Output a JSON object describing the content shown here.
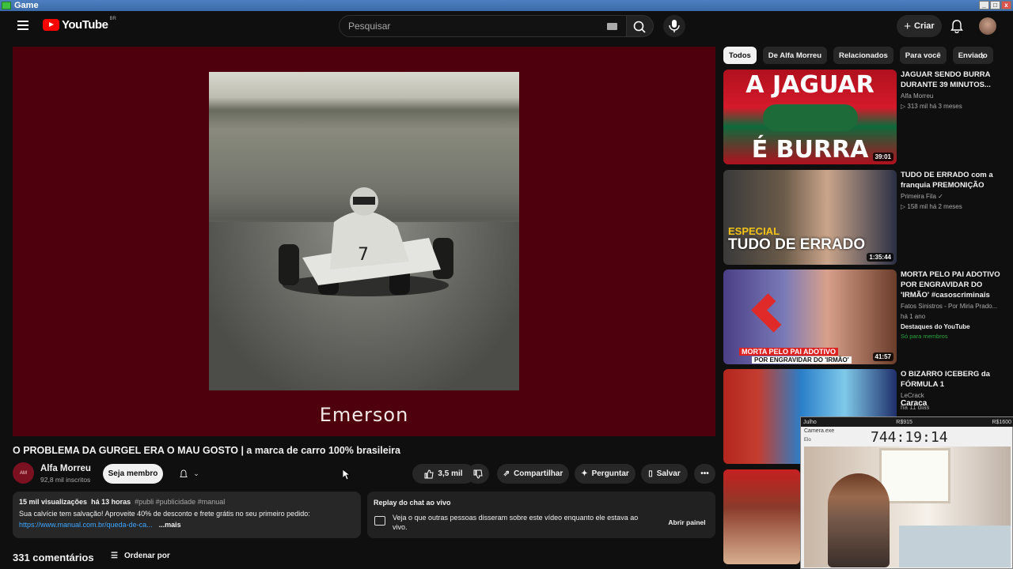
{
  "os": {
    "title": "Game"
  },
  "header": {
    "logo_text": "YouTube",
    "logo_country": "BR",
    "search_placeholder": "Pesquisar",
    "create_label": "Criar"
  },
  "player": {
    "caption": "Emerson"
  },
  "video": {
    "title": "O PROBLEMA DA GURGEL ERA O MAU GOSTO | a marca de carro 100% brasileira",
    "channel_name": "Alfa Morreu",
    "subscribers": "92,8 mil inscritos",
    "join_label": "Seja membro",
    "likes": "3,5 mil",
    "share_label": "Compartilhar",
    "ask_label": "Perguntar",
    "save_label": "Salvar"
  },
  "description": {
    "views": "15 mil visualizações",
    "date": "há 13 horas",
    "tags": "#publi #publicidade #manual",
    "line2": "Sua calvície tem salvação! Aproveite 40% de desconto e frete grátis no seu primeiro pedido:",
    "link": "https://www.manual.com.br/queda-de-ca...",
    "more": "...mais"
  },
  "chat": {
    "heading": "Replay do chat ao vivo",
    "text": "Veja o que outras pessoas disseram sobre este vídeo enquanto ele estava ao vivo.",
    "button": "Abrir painel"
  },
  "comments": {
    "count_label": "331 comentários",
    "sort_label": "Ordenar por"
  },
  "chips": [
    "Todos",
    "De Alfa Morreu",
    "Relacionados",
    "Para você",
    "Enviado"
  ],
  "recommendations": [
    {
      "title": "JAGUAR SENDO BURRA DURANTE 39 MINUTOS...",
      "channel": "Alfa Morreu",
      "stats": "▷ 313 mil  há 3 meses",
      "duration": "39:01",
      "thumb_top": "A JAGUAR",
      "thumb_bottom": "É BURRA"
    },
    {
      "title": "TUDO DE ERRADO com a franquia PREMONIÇÃO",
      "channel": "Primeira Fila ✓",
      "stats": "▷ 158 mil  há 2 meses",
      "duration": "1:35:44",
      "thumb_top": "ESPECIAL",
      "thumb_bottom": "TUDO DE ERRADO"
    },
    {
      "title": "MORTA PELO PAI ADOTIVO POR ENGRAVIDAR DO 'IRMÃO' #casoscriminais",
      "channel": "Fatos Sinistros - Por Miria Prado...",
      "stats": "há 1 ano",
      "badge": "Destaques do YouTube",
      "members": "Só para membros",
      "duration": "41:57",
      "thumb_bottom": "MORTA PELO PAI ADOTIVO",
      "thumb_bottom2": "POR ENGRAVIDAR DO 'IRMÃO'"
    },
    {
      "title": "O BIZARRO ICEBERG da FÓRMULA 1",
      "channel": "LeCrack",
      "stats": "há 11 dias"
    }
  ],
  "overlay": {
    "month": "Julho",
    "money1": "R$915",
    "money2": "R$1600",
    "window_title": "Camera.exe",
    "clock": "744:19:14",
    "floating_text": "Caraca",
    "small": "Elo"
  }
}
